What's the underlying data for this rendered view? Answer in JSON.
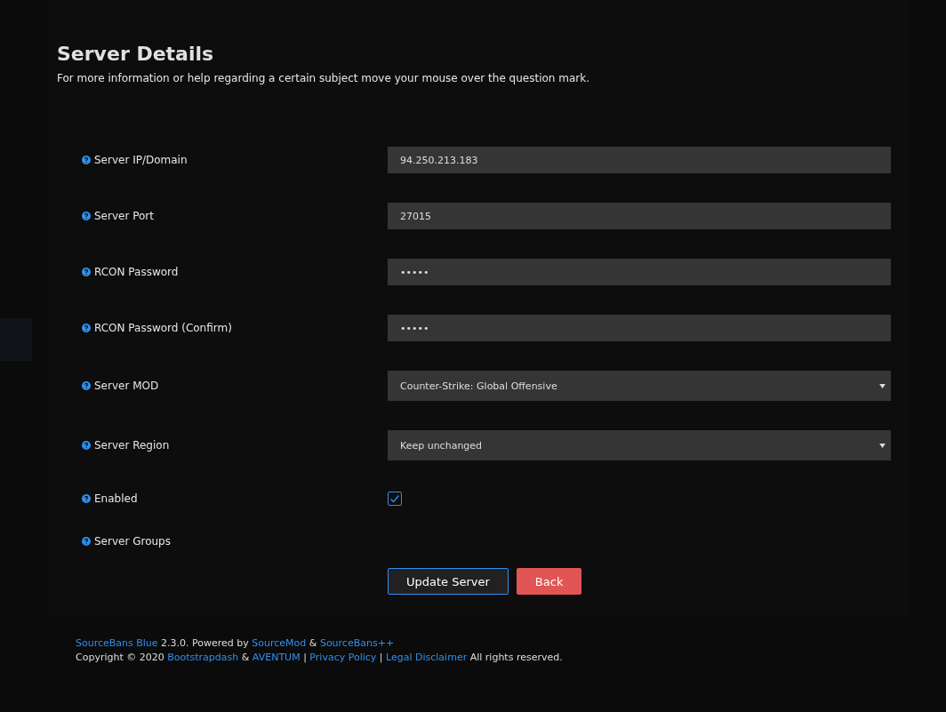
{
  "header": {
    "title": "Server Details",
    "subtitle": "For more information or help regarding a certain subject move your mouse over the question mark."
  },
  "fields": [
    {
      "kind": "text",
      "label": "Server IP/Domain",
      "value": "94.250.213.183"
    },
    {
      "kind": "text",
      "label": "Server Port",
      "value": "27015"
    },
    {
      "kind": "text",
      "label": "RCON Password",
      "value": "•••••"
    },
    {
      "kind": "text",
      "label": "RCON Password (Confirm)",
      "value": "•••••"
    },
    {
      "kind": "select",
      "label": "Server MOD",
      "value": "Counter-Strike: Global Offensive"
    },
    {
      "kind": "select",
      "label": "Server Region",
      "value": "Keep unchanged"
    },
    {
      "kind": "checkbox",
      "label": "Enabled",
      "checked": true
    },
    {
      "kind": "none",
      "label": "Server Groups"
    }
  ],
  "buttons": [
    {
      "kind": "primary",
      "label": "Update Server"
    },
    {
      "kind": "danger",
      "label": "Back"
    }
  ],
  "footer": [
    [
      {
        "kind": "link",
        "text": "SourceBans Blue"
      },
      {
        "kind": "text",
        "text": " 2.3.0. Powered by "
      },
      {
        "kind": "link",
        "text": "SourceMod"
      },
      {
        "kind": "text",
        "text": " & "
      },
      {
        "kind": "link",
        "text": "SourceBans++"
      }
    ],
    [
      {
        "kind": "text",
        "text": "Copyright © 2020 "
      },
      {
        "kind": "link",
        "text": "Bootstrapdash"
      },
      {
        "kind": "text",
        "text": " & "
      },
      {
        "kind": "link",
        "text": "AVENTUM"
      },
      {
        "kind": "text",
        "text": " | "
      },
      {
        "kind": "link",
        "text": "Privacy Policy"
      },
      {
        "kind": "text",
        "text": " | "
      },
      {
        "kind": "link",
        "text": "Legal Disclaimer"
      },
      {
        "kind": "text",
        "text": " All rights reserved."
      }
    ]
  ]
}
